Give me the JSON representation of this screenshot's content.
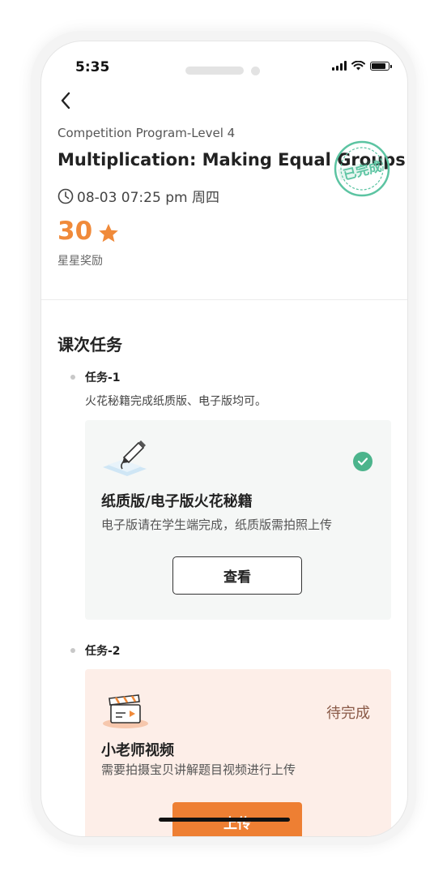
{
  "status_bar": {
    "time": "5:35"
  },
  "header": {
    "subtitle": "Competition Program-Level 4",
    "title": "Multiplication: Making Equal Groups",
    "datetime": "08-03 07:25 pm 周四",
    "stars": "30",
    "stars_label": "星星奖励",
    "stamp_text": "已完成"
  },
  "section_title": "课次任务",
  "tasks": [
    {
      "name": "任务-1",
      "desc": "火花秘籍完成纸质版、电子版均可。",
      "card_title": "纸质版/电子版火花秘籍",
      "card_sub": "电子版请在学生端完成，纸质版需拍照上传",
      "button": "查看",
      "completed": true
    },
    {
      "name": "任务-2",
      "card_title": "小老师视频",
      "card_sub": "需要拍摄宝贝讲解题目视频进行上传",
      "status": "待完成",
      "button": "上传"
    }
  ],
  "colors": {
    "accent": "#ee7f33",
    "success": "#4cb48c",
    "pending_bg": "#fdeee8",
    "done_bg": "#f5f7f6"
  },
  "icons": [
    "back-arrow-icon",
    "clock-icon",
    "star-icon",
    "pencil-paper-icon",
    "check-icon",
    "video-clapper-icon",
    "completed-stamp"
  ]
}
